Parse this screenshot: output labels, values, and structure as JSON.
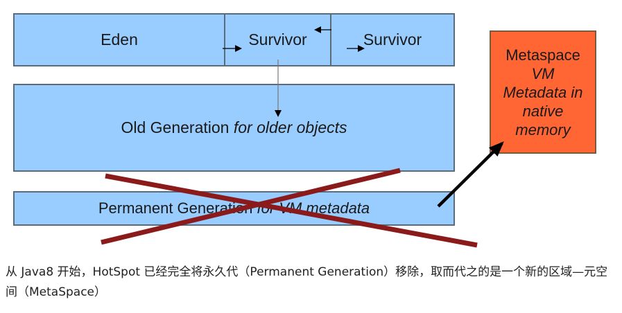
{
  "diagram": {
    "eden_label": "Eden",
    "survivor1_label": "Survivor",
    "survivor2_label": "Survivor",
    "old_gen_label": "Old Generation",
    "old_gen_italic": "for older objects",
    "perm_gen_label": "Permanent Generation",
    "perm_gen_italic": "for VM metadata",
    "metaspace_title": "Metaspace",
    "metaspace_lines": [
      "VM",
      "Metadata in",
      "native",
      "memory"
    ]
  },
  "colors": {
    "heap_box": "#99ccff",
    "metaspace_box": "#ff6633",
    "cross": "#8b1a1a",
    "arrow": "#000000"
  },
  "caption": {
    "text": "从 Java8 开始，HotSpot 已经完全将永久代（Permanent Generation）移除，取而代之的是一个新的区域—元空间（MetaSpace）"
  }
}
